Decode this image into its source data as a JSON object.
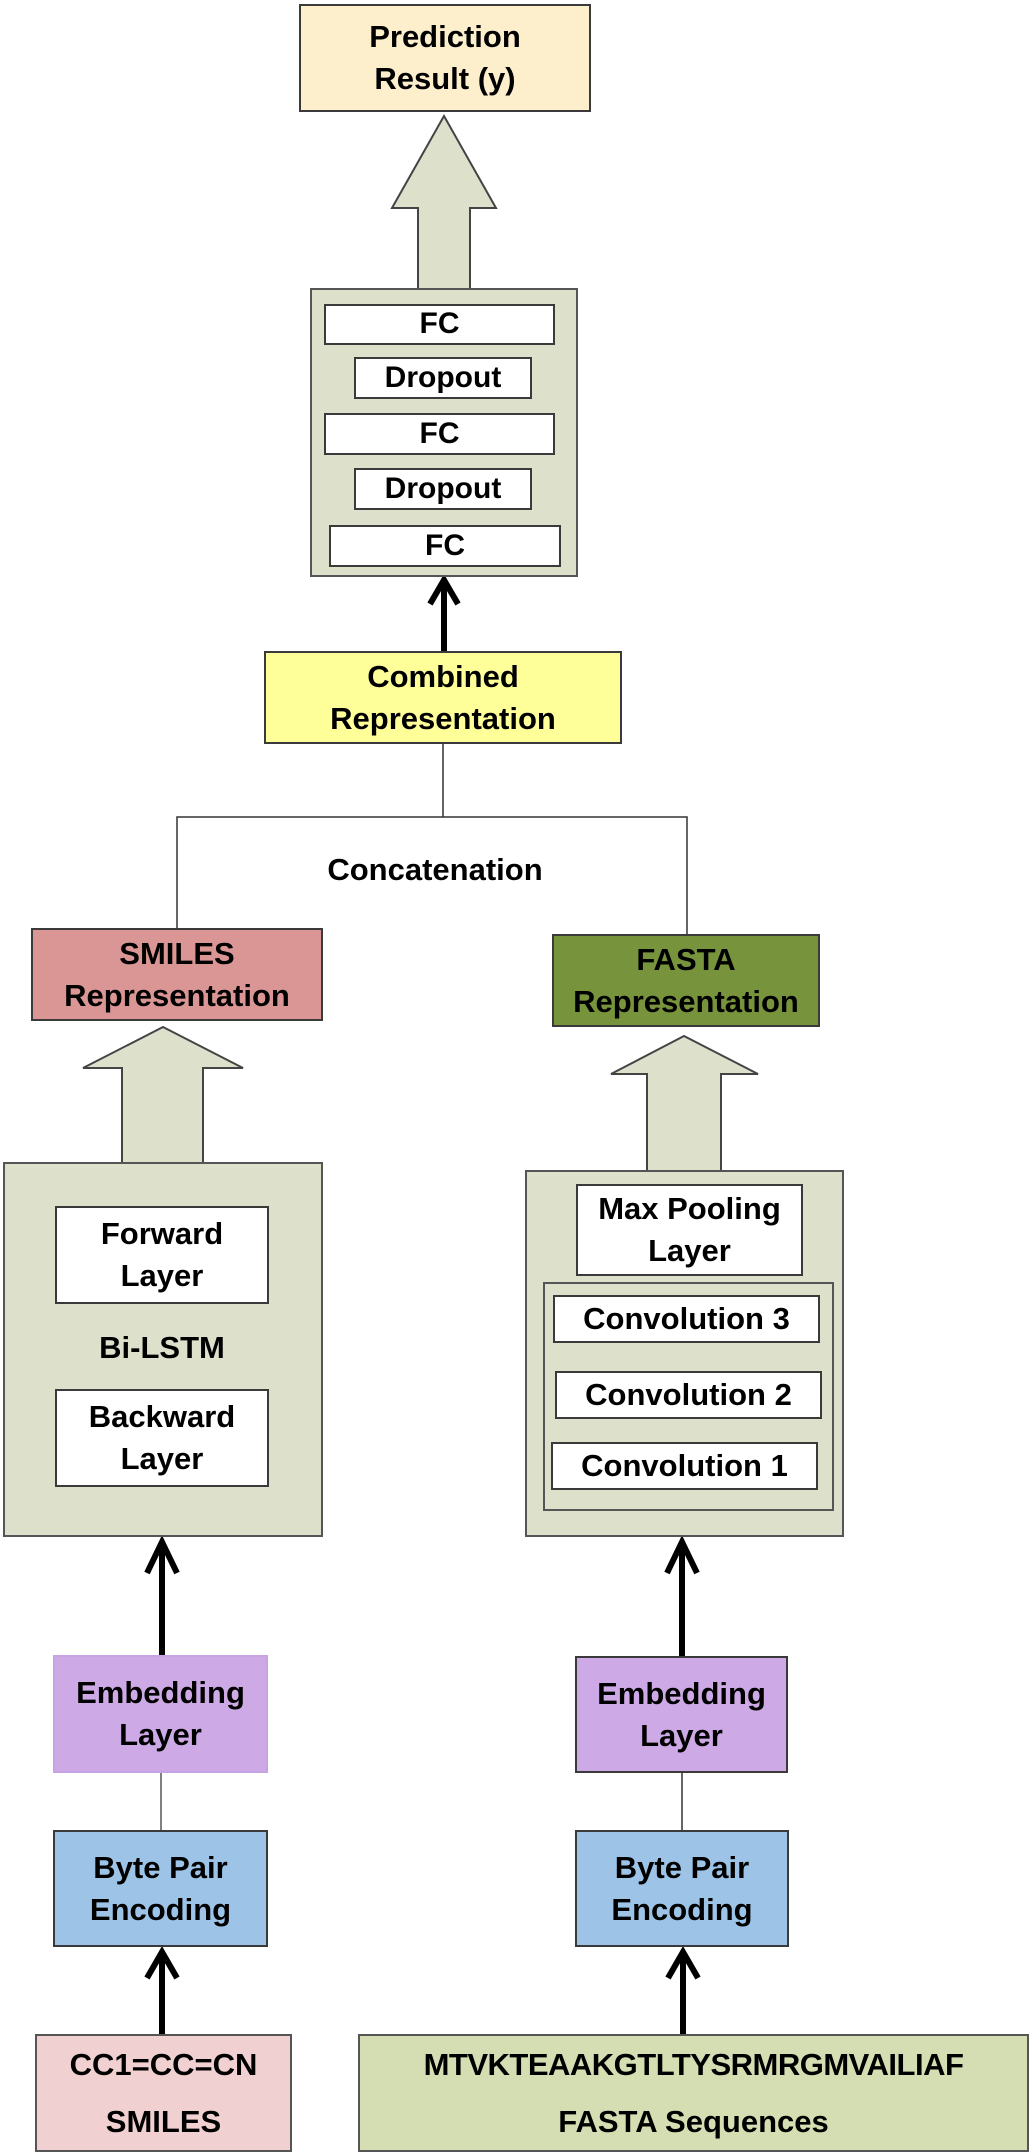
{
  "colors": {
    "prediction": "#fdeecc",
    "block": "#dde0cb",
    "combined": "#ffff99",
    "smiles_repr": "#da9694",
    "fasta_repr": "#77933c",
    "embedding": "#cda9e6",
    "bpe": "#9dc3e6",
    "smiles_input": "#f0d0d0",
    "fasta_input": "#d4deb2"
  },
  "output": {
    "label": "Prediction\nResult (y)"
  },
  "fc_block": {
    "layers": [
      "FC",
      "Dropout",
      "FC",
      "Dropout",
      "FC"
    ]
  },
  "combined": {
    "label": "Combined\nRepresentation"
  },
  "concatenation": {
    "label": "Concatenation"
  },
  "smiles_branch": {
    "representation": "SMILES\nRepresentation",
    "bilstm_label": "Bi-LSTM",
    "forward": "Forward\nLayer",
    "backward": "Backward\nLayer",
    "embedding": "Embedding\nLayer",
    "bpe": "Byte Pair\nEncoding",
    "input_value": "CC1=CC=CN",
    "input_caption": "SMILES"
  },
  "fasta_branch": {
    "representation": "FASTA\nRepresentation",
    "max_pooling": "Max Pooling\nLayer",
    "convolutions": [
      "Convolution 3",
      "Convolution 2",
      "Convolution 1"
    ],
    "embedding": "Embedding\nLayer",
    "bpe": "Byte Pair\nEncoding",
    "input_value": "MTVKTEAAKGTLTYSRMRGMVAILIAF",
    "input_caption": "FASTA Sequences"
  }
}
